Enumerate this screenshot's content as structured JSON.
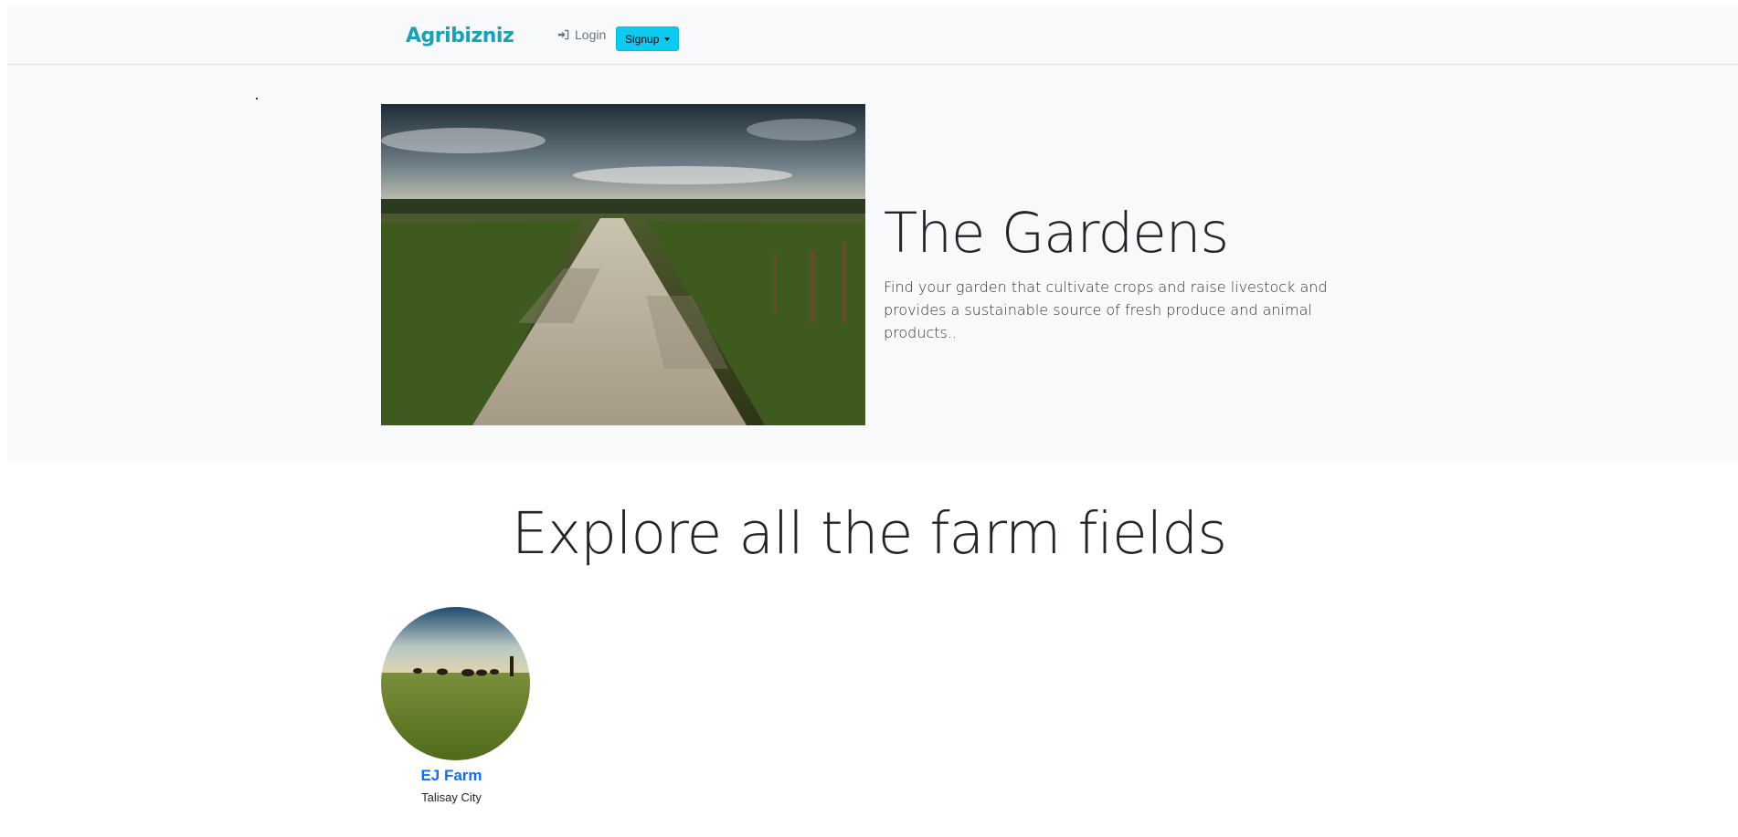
{
  "navbar": {
    "brand": "Agribizniz",
    "login_label": "Login",
    "signup_label": "Signup"
  },
  "hero": {
    "title": "The Gardens",
    "description": "Find your garden that cultivate crops and raise livestock and provides a sustainable source of fresh produce and animal products.."
  },
  "section": {
    "title": "Explore all the farm fields"
  },
  "farms": [
    {
      "name": "EJ Farm",
      "location": "Talisay City"
    }
  ],
  "colors": {
    "brand": "#17a2b8",
    "signup_bg": "#0dcaf0",
    "link": "#0d6efd",
    "hero_bg": "#f8f9fa"
  }
}
